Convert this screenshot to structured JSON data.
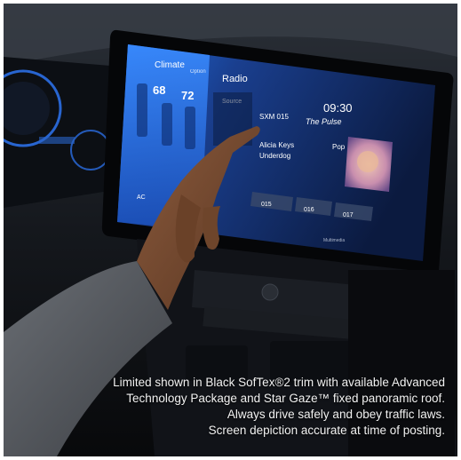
{
  "screen": {
    "climate_title": "Climate",
    "climate_option": "Option",
    "temp_left": "68",
    "temp_right": "72",
    "fan_label": "AC",
    "radio_title": "Radio",
    "source_label": "Source",
    "station": "SXM 015",
    "channel_name": "The Pulse",
    "artist": "Alicia Keys",
    "song": "Underdog",
    "genre": "Pop",
    "time": "09:30",
    "presets": [
      "015",
      "016",
      "017"
    ],
    "brand_small": "Multimedia"
  },
  "caption": {
    "line1": "Limited shown in Black SofTex®2 trim with available Advanced",
    "line2": "Technology Package and Star Gaze™ fixed panoramic roof.",
    "line3": "Always drive safely and obey traffic laws.",
    "line4": "Screen depiction accurate at time of posting."
  }
}
